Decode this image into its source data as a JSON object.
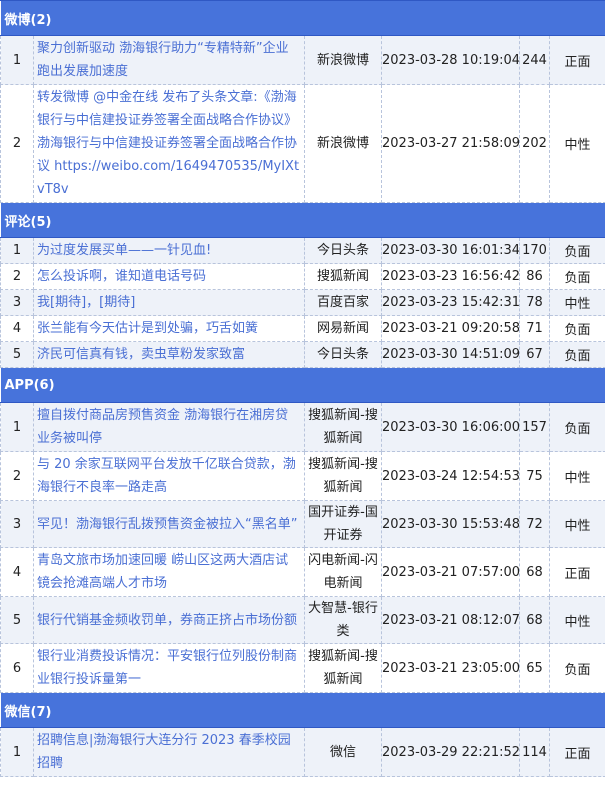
{
  "sections": [
    {
      "header": "微博(2)",
      "rows": [
        {
          "idx": "1",
          "title": "聚力创新驱动 渤海银行助力“专精特新”企业跑出发展加速度",
          "source": "新浪微博",
          "time": "2023-03-28 10:19:04",
          "count": "244",
          "sentiment": "正面"
        },
        {
          "idx": "2",
          "title": "转发微博 @中金在线 发布了头条文章:《渤海银行与中信建投证券签署全面战略合作协议》 渤海银行与中信建投证券签署全面战略合作协议 https://weibo.com/1649470535/MyIXtvT8v",
          "source": "新浪微博",
          "time": "2023-03-27 21:58:09",
          "count": "202",
          "sentiment": "中性"
        }
      ]
    },
    {
      "header": "评论(5)",
      "rows": [
        {
          "idx": "1",
          "title": "为过度发展买单——一针见血!",
          "source": "今日头条",
          "time": "2023-03-30 16:01:34",
          "count": "170",
          "sentiment": "负面"
        },
        {
          "idx": "2",
          "title": "怎么投诉啊，谁知道电话号码",
          "source": "搜狐新闻",
          "time": "2023-03-23 16:56:42",
          "count": "86",
          "sentiment": "负面"
        },
        {
          "idx": "3",
          "title": "我[期待]，[期待]",
          "source": "百度百家",
          "time": "2023-03-23 15:42:31",
          "count": "78",
          "sentiment": "中性"
        },
        {
          "idx": "4",
          "title": "张兰能有今天估计是到处骗，巧舌如簧",
          "source": "网易新闻",
          "time": "2023-03-21 09:20:58",
          "count": "71",
          "sentiment": "负面"
        },
        {
          "idx": "5",
          "title": "济民可信真有钱，卖虫草粉发家致富",
          "source": "今日头条",
          "time": "2023-03-30 14:51:09",
          "count": "67",
          "sentiment": "负面"
        }
      ]
    },
    {
      "header": "APP(6)",
      "rows": [
        {
          "idx": "1",
          "title": "擅自拨付商品房预售资金 渤海银行在湘房贷业务被叫停",
          "source": "搜狐新闻-搜狐新闻",
          "time": "2023-03-30 16:06:00",
          "count": "157",
          "sentiment": "负面"
        },
        {
          "idx": "2",
          "title": "与 20 余家互联网平台发放千亿联合贷款，渤海银行不良率一路走高",
          "source": "搜狐新闻-搜狐新闻",
          "time": "2023-03-24 12:54:53",
          "count": "75",
          "sentiment": "中性"
        },
        {
          "idx": "3",
          "title": "罕见！渤海银行乱拨预售资金被拉入“黑名单”",
          "source": "国开证券-国开证券",
          "time": "2023-03-30 15:53:48",
          "count": "72",
          "sentiment": "中性"
        },
        {
          "idx": "4",
          "title": "青岛文旅市场加速回暖 崂山区这两大酒店试镜会抢滩高端人才市场",
          "source": "闪电新闻-闪电新闻",
          "time": "2023-03-21 07:57:00",
          "count": "68",
          "sentiment": "正面"
        },
        {
          "idx": "5",
          "title": "银行代销基金频收罚单，券商正挤占市场份额",
          "source": "大智慧-银行类",
          "time": "2023-03-21 08:12:07",
          "count": "68",
          "sentiment": "中性"
        },
        {
          "idx": "6",
          "title": "银行业消费投诉情况：平安银行位列股份制商业银行投诉量第一",
          "source": "搜狐新闻-搜狐新闻",
          "time": "2023-03-21 23:05:00",
          "count": "65",
          "sentiment": "负面"
        }
      ]
    },
    {
      "header": "微信(7)",
      "rows": [
        {
          "idx": "1",
          "title": "招聘信息|渤海银行大连分行 2023 春季校园招聘",
          "source": "微信",
          "time": "2023-03-29 22:21:52",
          "count": "114",
          "sentiment": "正面"
        }
      ]
    }
  ]
}
